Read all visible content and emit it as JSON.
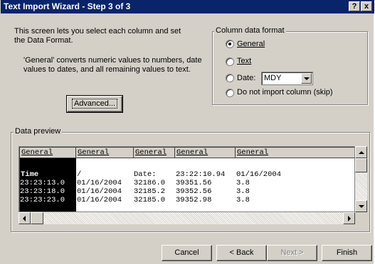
{
  "window": {
    "title": "Text Import Wizard - Step 3 of 3",
    "help_label": "?",
    "close_label": "x"
  },
  "intro": {
    "line1": "This screen lets you select each column and set",
    "line2": "the Data Format.",
    "general1": "'General' converts numeric values to numbers, date",
    "general2": "values to dates, and all remaining values to text."
  },
  "column_format": {
    "legend": "Column data format",
    "options": [
      {
        "label": "General",
        "selected": true
      },
      {
        "label": "Text",
        "selected": false
      },
      {
        "label": "Date:",
        "selected": false
      },
      {
        "label": "Do not import column (skip)",
        "selected": false
      }
    ],
    "date_value": "MDY"
  },
  "advanced_label": "Advanced...",
  "preview": {
    "legend": "Data preview",
    "headers": [
      "General",
      "General",
      "General",
      "General",
      "General"
    ],
    "rows": [
      [
        "Time",
        "/",
        "Date:",
        "23:22:10.94",
        "01/16/2004"
      ],
      [
        "23:23:13.0",
        "01/16/2004",
        "32186.0",
        "39351.56",
        "3.8"
      ],
      [
        "23:23:18.0",
        "01/16/2004",
        "32185.2",
        "39352.56",
        "3.8"
      ],
      [
        "23:23:23.0",
        "01/16/2004",
        "32185.0",
        "39352.98",
        "3.8"
      ]
    ]
  },
  "buttons": {
    "cancel": "Cancel",
    "back": "< Back",
    "next": "Next >",
    "finish": "Finish"
  },
  "colors": {
    "title_bar": "#0a246a",
    "face": "#d4d0c8",
    "selected_column": "#000000"
  }
}
